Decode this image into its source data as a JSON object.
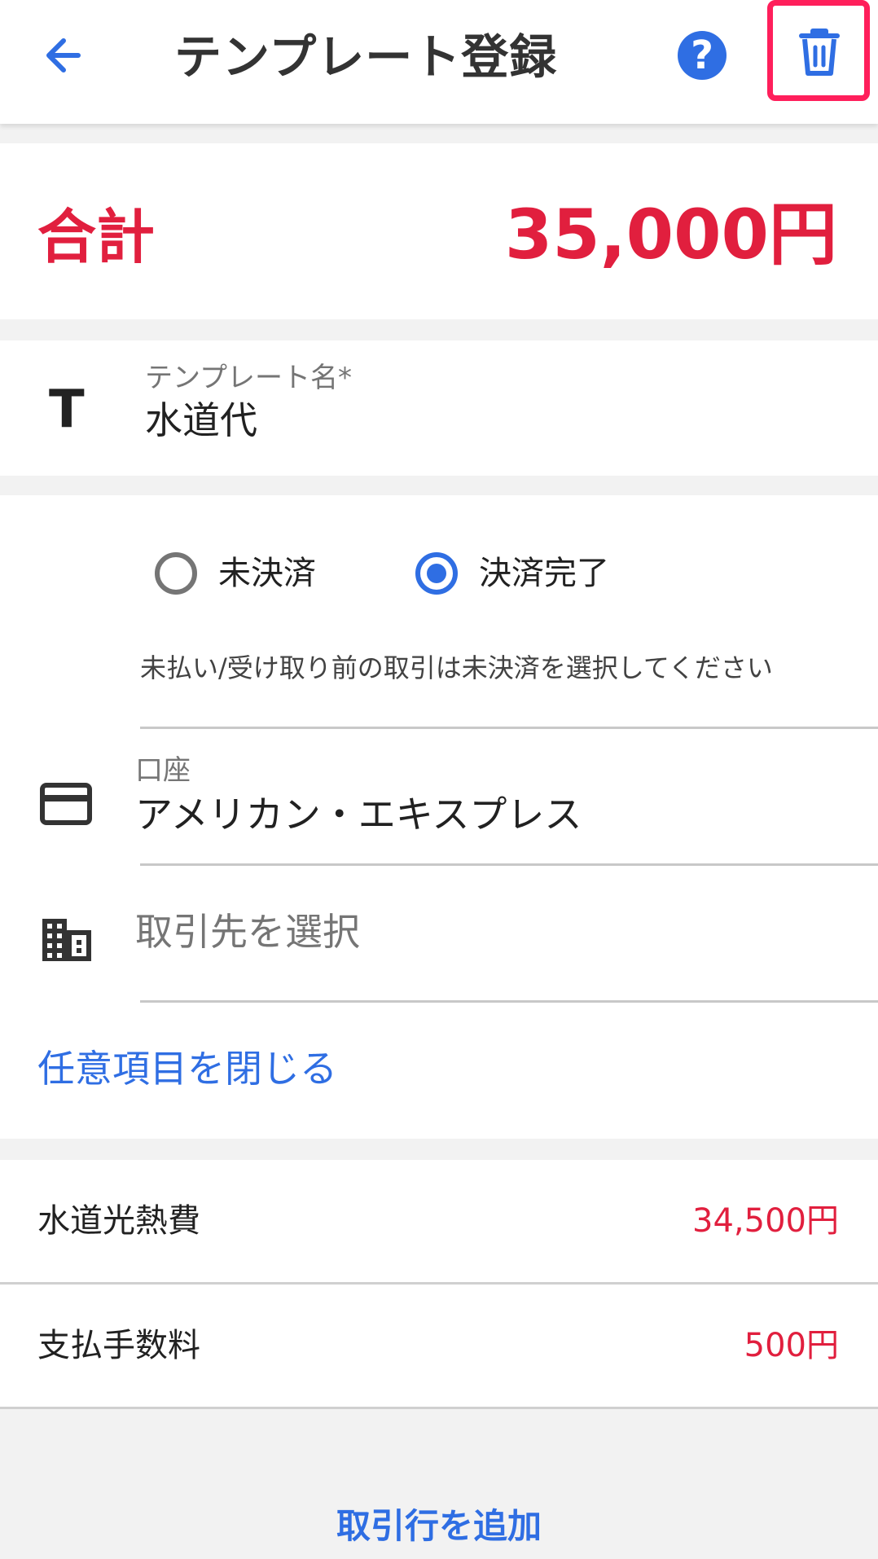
{
  "appbar": {
    "title": "テンプレート登録",
    "help_label": "?"
  },
  "total": {
    "label": "合計",
    "value": "35,000円"
  },
  "template_name": {
    "label": "テンプレート名*",
    "value": "水道代",
    "icon_text": "T"
  },
  "status": {
    "options": [
      {
        "label": "未決済",
        "selected": false
      },
      {
        "label": "決済完了",
        "selected": true
      }
    ],
    "hint": "未払い/受け取り前の取引は未決済を選択してください"
  },
  "account": {
    "label": "口座",
    "value": "アメリカン・エキスプレス"
  },
  "partner": {
    "placeholder": "取引先を選択"
  },
  "toggle_optional": "任意項目を閉じる",
  "lines": [
    {
      "name": "水道光熱費",
      "amount": "34,500円"
    },
    {
      "name": "支払手数料",
      "amount": "500円"
    }
  ],
  "add_line": "取引行を追加",
  "colors": {
    "accent": "#2f6ee3",
    "amount_red": "#e11f3e",
    "highlight": "#ff1f5b"
  },
  "icons": [
    "back-arrow-icon",
    "help-icon",
    "trash-icon",
    "text-icon",
    "credit-card-icon",
    "building-icon"
  ]
}
